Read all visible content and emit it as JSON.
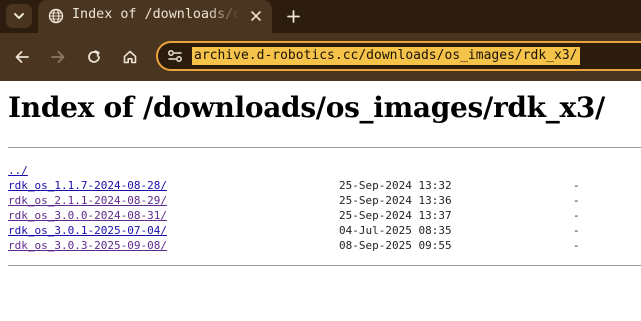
{
  "browser": {
    "tab": {
      "title": "Index of /downloads/os_images/rdk_x3/",
      "favicon": "globe-icon"
    },
    "address_bar": {
      "url": "archive.d-robotics.cc/downloads/os_images/rdk_x3/"
    },
    "colors": {
      "tabstrip": "#2d1d0f",
      "toolbar": "#4a3620",
      "omnibox_border": "#e8a33c",
      "url_highlight": "#f5c24a"
    }
  },
  "page": {
    "heading": "Index of /downloads/os_images/rdk_x3/",
    "entries": [
      {
        "name": "../",
        "date": "",
        "size": "",
        "visited": false
      },
      {
        "name": "rdk_os_1.1.7-2024-08-28/",
        "date": "25-Sep-2024 13:32",
        "size": "-",
        "visited": false
      },
      {
        "name": "rdk_os_2.1.1-2024-08-29/",
        "date": "25-Sep-2024 13:36",
        "size": "-",
        "visited": true
      },
      {
        "name": "rdk_os_3.0.0-2024-08-31/",
        "date": "25-Sep-2024 13:37",
        "size": "-",
        "visited": true
      },
      {
        "name": "rdk_os_3.0.1-2025-07-04/",
        "date": "04-Jul-2025 08:35",
        "size": "-",
        "visited": false
      },
      {
        "name": "rdk_os_3.0.3-2025-09-08/",
        "date": "08-Sep-2025 09:55",
        "size": "-",
        "visited": true
      }
    ]
  }
}
